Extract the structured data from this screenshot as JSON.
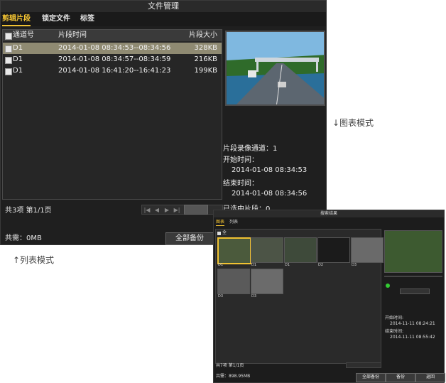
{
  "list_window": {
    "title": "文件管理",
    "tabs": [
      "剪辑片段",
      "锁定文件",
      "标签"
    ],
    "columns": [
      "通道号",
      "片段时间",
      "片段大小"
    ],
    "rows": [
      {
        "channel": "D1",
        "time": "2014-01-08 08:34:53--08:34:56",
        "size": "328KB",
        "selected": true
      },
      {
        "channel": "D1",
        "time": "2014-01-08 08:34:57--08:34:59",
        "size": "216KB",
        "selected": false
      },
      {
        "channel": "D1",
        "time": "2014-01-08 16:41:20--16:41:23",
        "size": "199KB",
        "selected": false
      }
    ],
    "info": {
      "channel_line": "片段录像通道：1",
      "start_label": "开始时间：",
      "start_value": "2014-01-08 08:34:53",
      "end_label": "结束时间：",
      "end_value": "2014-01-08 08:34:56",
      "selected_line": "已选中片段：0"
    },
    "summary": "共3项 第1/1页",
    "total": "共需：0MB",
    "backup_all": "全部备份"
  },
  "captions": {
    "chart_mode": "↓图表模式",
    "list_mode": "↑列表模式"
  },
  "chart_window": {
    "title": "搜索结果",
    "tabs": [
      "图表",
      "列表"
    ],
    "select_all": "全",
    "thumbs": [
      {
        "label": "D1",
        "selected": true,
        "tone": "#4b5a3c"
      },
      {
        "label": "D1",
        "selected": false,
        "tone": "#4c5446"
      },
      {
        "label": "D1",
        "selected": false,
        "tone": "#3e4a3a"
      },
      {
        "label": "D2",
        "selected": false,
        "tone": "#1b1b1b"
      },
      {
        "label": "D3",
        "selected": false,
        "tone": "#6a6a6a"
      },
      {
        "label": "D3",
        "selected": false,
        "tone": "#5a5a5a"
      },
      {
        "label": "D3",
        "selected": false,
        "tone": "#6b6b6b"
      }
    ],
    "start_label": "开始时间:",
    "start_value": "2014-11-11 08:24:21",
    "end_label": "结束时间:",
    "end_value": "2014-11-11 08:55:42",
    "summary": "共7项 第1/1页",
    "total": "共需：898.95MB",
    "buttons": [
      "全部备份",
      "备份",
      "返回"
    ]
  }
}
